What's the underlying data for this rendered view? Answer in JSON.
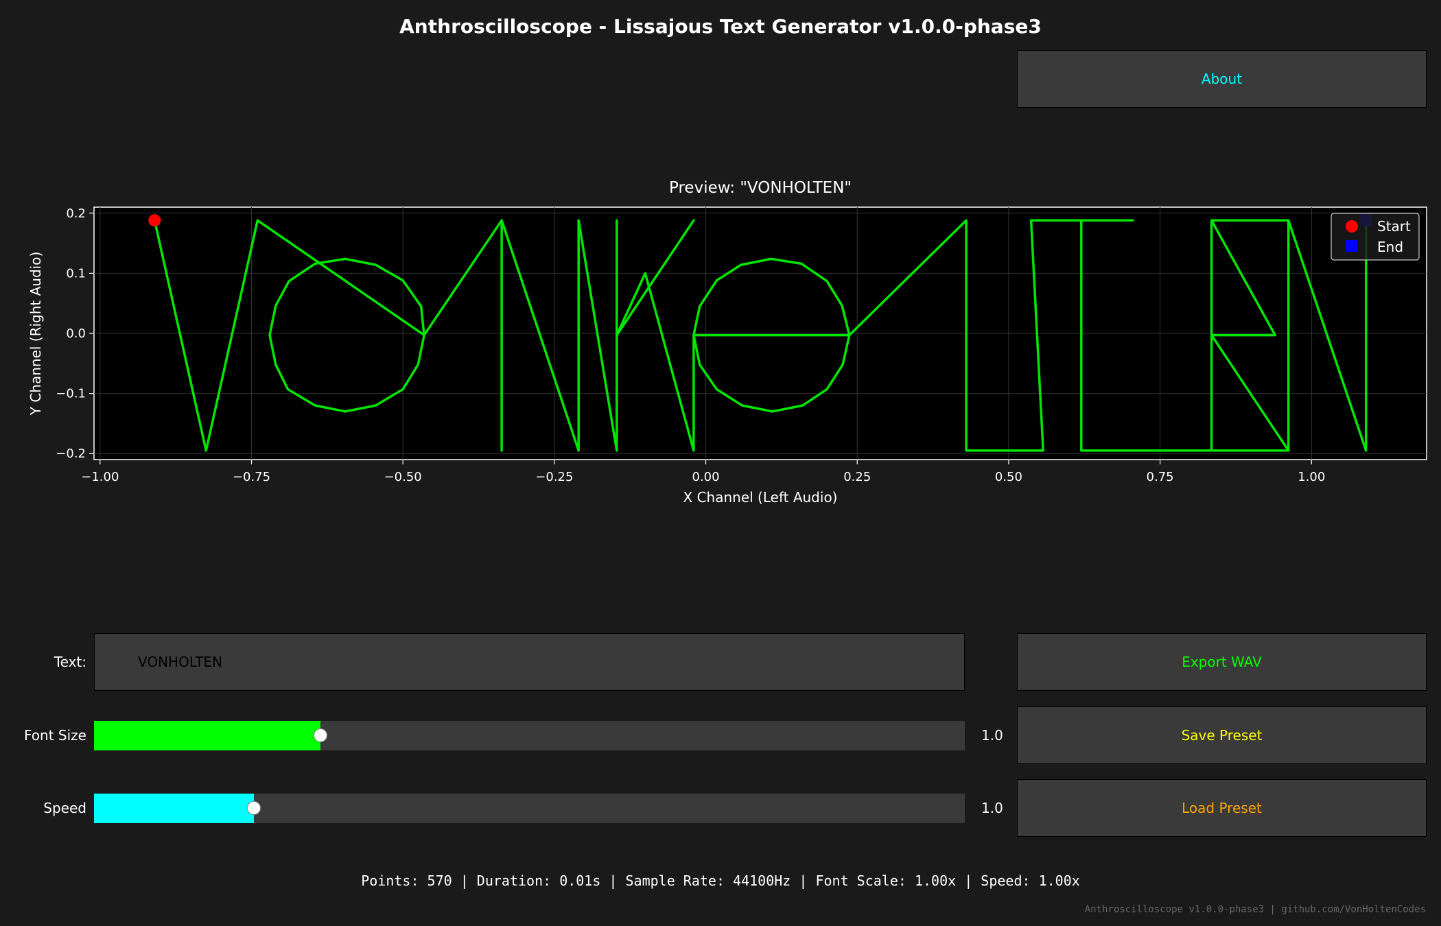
{
  "app_title": "Anthroscilloscope - Lissajous Text Generator v1.0.0-phase3",
  "buttons": {
    "about": "About",
    "export_wav": "Export WAV",
    "save_preset": "Save Preset",
    "load_preset": "Load Preset"
  },
  "colors": {
    "about": "#00ffff",
    "export_wav": "#00ff00",
    "save_preset": "#ffff00",
    "load_preset": "#ffa500",
    "trace": "#00e600",
    "start_marker": "#ff0000",
    "end_marker": "#0000ff",
    "font_size_fill": "#00ff00",
    "speed_fill": "#00ffff"
  },
  "controls": {
    "text_label": "Text:",
    "text_value": "VONHOLTEN",
    "font_size_label": "Font Size",
    "font_size_value": "1.0",
    "font_size_fraction": 0.26,
    "speed_label": "Speed",
    "speed_value": "1.0",
    "speed_fraction": 0.184
  },
  "status_line": "Points: 570 | Duration: 0.01s | Sample Rate: 44100Hz | Font Scale: 1.00x | Speed: 1.00x",
  "footer": "Anthroscilloscope v1.0.0-phase3 | github.com/VonHoltenCodes",
  "chart_data": {
    "type": "line",
    "title": "Preview: \"VONHOLTEN\"",
    "xlabel": "X Channel (Left Audio)",
    "ylabel": "Y Channel (Right Audio)",
    "xlim": [
      -1.01,
      1.19
    ],
    "ylim": [
      -0.21,
      0.21
    ],
    "xticks": [
      -1.0,
      -0.75,
      -0.5,
      -0.25,
      0.0,
      0.25,
      0.5,
      0.75,
      1.0
    ],
    "xtick_labels": [
      "−1.00",
      "−0.75",
      "−0.50",
      "−0.25",
      "0.00",
      "0.25",
      "0.50",
      "0.75",
      "1.00"
    ],
    "yticks": [
      0.2,
      0.1,
      0.0,
      -0.1,
      -0.2
    ],
    "ytick_labels": [
      "0.2",
      "0.1",
      "0.0",
      "−0.1",
      "−0.2"
    ],
    "grid": true,
    "legend": {
      "placement": "top-right",
      "entries": [
        "Start",
        "End"
      ]
    },
    "start_point": [
      -0.91,
      0.188
    ],
    "end_point": [
      1.09,
      0.188
    ],
    "series": [
      {
        "points": [
          [
            -0.91,
            0.188
          ],
          [
            -0.825,
            -0.195
          ],
          [
            -0.74,
            0.188
          ],
          [
            -0.465,
            -0.003
          ],
          [
            -0.47,
            0.045
          ],
          [
            -0.5,
            0.088
          ],
          [
            -0.545,
            0.114
          ],
          [
            -0.595,
            0.124
          ],
          [
            -0.645,
            0.116
          ],
          [
            -0.688,
            0.087
          ],
          [
            -0.71,
            0.046
          ],
          [
            -0.72,
            -0.003
          ],
          [
            -0.71,
            -0.052
          ],
          [
            -0.69,
            -0.093
          ],
          [
            -0.645,
            -0.12
          ],
          [
            -0.595,
            -0.13
          ],
          [
            -0.545,
            -0.12
          ],
          [
            -0.5,
            -0.093
          ],
          [
            -0.475,
            -0.052
          ],
          [
            -0.465,
            -0.003
          ],
          [
            -0.337,
            0.188
          ],
          [
            -0.337,
            -0.195
          ],
          [
            -0.337,
            0.188
          ],
          [
            -0.21,
            -0.195
          ],
          [
            -0.21,
            0.188
          ],
          [
            -0.147,
            -0.195
          ],
          [
            -0.147,
            0.188
          ],
          [
            -0.147,
            -0.003
          ],
          [
            -0.02,
            0.188
          ],
          [
            -0.147,
            -0.003
          ],
          [
            -0.1,
            0.1
          ],
          [
            -0.02,
            -0.195
          ],
          [
            -0.02,
            -0.003
          ],
          [
            -0.01,
            0.045
          ],
          [
            0.018,
            0.088
          ],
          [
            0.058,
            0.114
          ],
          [
            0.108,
            0.124
          ],
          [
            0.158,
            0.116
          ],
          [
            0.2,
            0.087
          ],
          [
            0.225,
            0.046
          ],
          [
            0.237,
            -0.003
          ],
          [
            0.226,
            -0.052
          ],
          [
            0.2,
            -0.093
          ],
          [
            0.16,
            -0.12
          ],
          [
            0.11,
            -0.13
          ],
          [
            0.06,
            -0.12
          ],
          [
            0.018,
            -0.093
          ],
          [
            -0.01,
            -0.052
          ],
          [
            -0.02,
            -0.003
          ],
          [
            0.237,
            -0.003
          ],
          [
            0.43,
            0.188
          ],
          [
            0.43,
            -0.195
          ],
          [
            0.557,
            -0.195
          ],
          [
            0.537,
            0.188
          ],
          [
            0.705,
            0.188
          ],
          [
            0.62,
            0.188
          ],
          [
            0.62,
            -0.195
          ],
          [
            0.835,
            -0.195
          ],
          [
            0.835,
            0.188
          ],
          [
            0.962,
            0.188
          ],
          [
            0.962,
            -0.195
          ],
          [
            0.835,
            -0.003
          ],
          [
            0.94,
            -0.003
          ],
          [
            0.835,
            0.188
          ],
          [
            0.835,
            -0.195
          ],
          [
            0.962,
            -0.195
          ],
          [
            0.962,
            0.188
          ],
          [
            1.09,
            -0.195
          ],
          [
            1.09,
            0.188
          ]
        ]
      }
    ]
  }
}
